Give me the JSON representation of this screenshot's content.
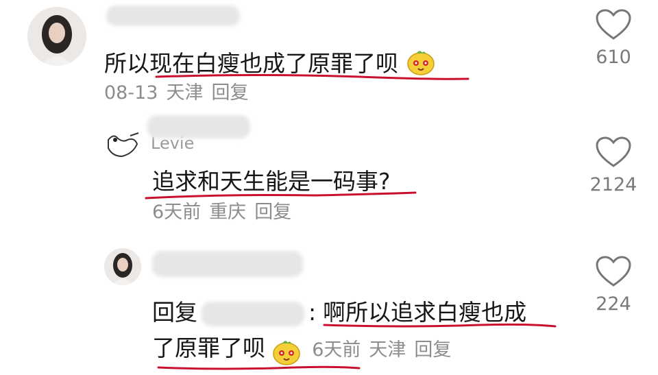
{
  "comments": [
    {
      "text": "所以现在白瘦也成了原罪了呗",
      "date": "08-13",
      "location": "天津",
      "reply_label": "回复",
      "likes": "610"
    },
    {
      "author_partial": "Levie",
      "text": "追求和天生能是一码事?",
      "date": "6天前",
      "location": "重庆",
      "reply_label": "回复",
      "likes": "2124"
    },
    {
      "reply_prefix": "回复",
      "reply_separator": ":",
      "text_line1": "啊所以追求白瘦也成",
      "text_line2": "了原罪了呗",
      "date": "6天前",
      "location": "天津",
      "reply_label": "回复",
      "likes": "224"
    }
  ],
  "colors": {
    "underline": "#c8102e",
    "meta": "#8c8c8c",
    "text": "#161616"
  },
  "icons": [
    "heart-outline-icon",
    "emoji-sticker-icon"
  ]
}
